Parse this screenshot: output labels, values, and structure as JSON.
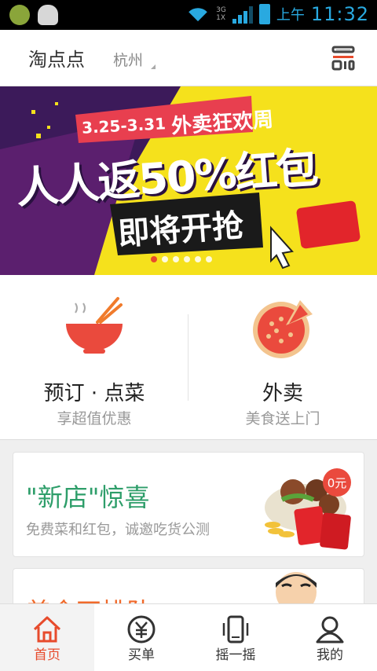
{
  "status_bar": {
    "network": "3G",
    "sim": "1X",
    "time_period": "上午",
    "time": "11:32"
  },
  "header": {
    "app_title": "淘点点",
    "city": "杭州",
    "scan_icon": "qr-scan-icon"
  },
  "banner": {
    "date_range": "3.25-3.31",
    "event": "外卖狂欢周",
    "headline": "人人返50%红包",
    "cta": "即将开抢",
    "slide_count": 6,
    "active_slide": 1
  },
  "entries": [
    {
      "title": "预订 · 点菜",
      "subtitle": "享超值优惠",
      "icon": "noodle-bowl-icon"
    },
    {
      "title": "外卖",
      "subtitle": "美食送上门",
      "icon": "pizza-icon"
    }
  ],
  "cards": [
    {
      "title": "\"新店\"惊喜",
      "subtitle": "免费菜和红包，诚邀吃货公测",
      "badge": "0元"
    },
    {
      "title": "美食不排队",
      "subtitle": ""
    }
  ],
  "tabbar": [
    {
      "label": "首页",
      "icon": "home-icon",
      "active": true
    },
    {
      "label": "买单",
      "icon": "yuan-pay-icon",
      "active": false
    },
    {
      "label": "摇一摇",
      "icon": "shake-phone-icon",
      "active": false
    },
    {
      "label": "我的",
      "icon": "user-icon",
      "active": false
    }
  ],
  "colors": {
    "accent": "#e74b2c",
    "green": "#2e9e6a",
    "status_blue": "#29a9e0",
    "banner_purple": "#3c1a5a",
    "banner_yellow": "#f5e11c"
  }
}
